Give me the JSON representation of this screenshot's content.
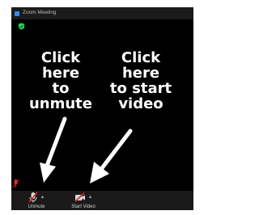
{
  "window": {
    "title": "Zoom Meeting"
  },
  "annotations": {
    "unmute_tip": [
      "Click",
      "here",
      "to",
      "unmute"
    ],
    "video_tip": [
      "Click",
      "here",
      "to start",
      "video"
    ]
  },
  "toolbar": {
    "unmute_label": "Unmute",
    "start_video_label": "Start Video"
  },
  "icons": {
    "shield": "shield-icon",
    "mic_muted": "microphone-muted-icon",
    "video_off": "video-off-icon",
    "caret": "caret-up-icon"
  },
  "colors": {
    "background": "#000000",
    "toolbar": "#1a1a1a",
    "shield": "#23d959",
    "muted_red": "#e02828",
    "annotation_text": "#ffffff"
  }
}
